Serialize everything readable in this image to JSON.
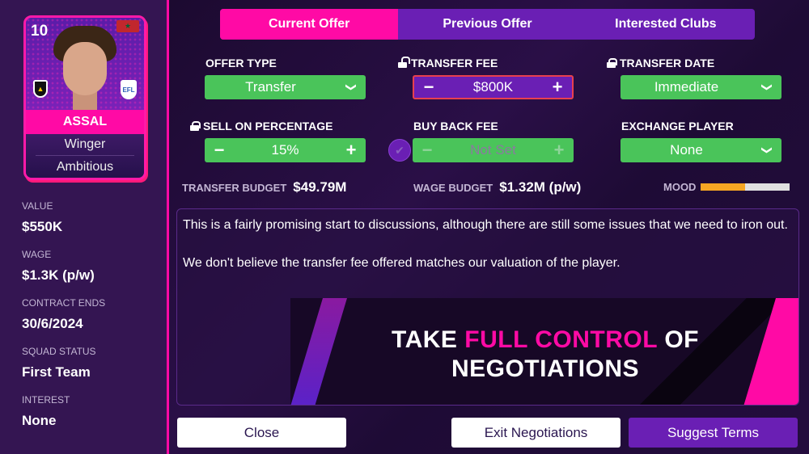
{
  "player": {
    "number": "10",
    "name": "ASSAL",
    "position": "Winger",
    "personality": "Ambitious",
    "flag": "Morocco",
    "club_badge": "club-crest",
    "league_badge": "EFL"
  },
  "stats": [
    {
      "label": "VALUE",
      "value": "$550K"
    },
    {
      "label": "WAGE",
      "value": "$1.3K (p/w)"
    },
    {
      "label": "CONTRACT ENDS",
      "value": "30/6/2024"
    },
    {
      "label": "SQUAD STATUS",
      "value": "First Team"
    },
    {
      "label": "INTEREST",
      "value": "None"
    }
  ],
  "tabs": [
    {
      "label": "Current Offer",
      "active": true
    },
    {
      "label": "Previous Offer",
      "active": false
    },
    {
      "label": "Interested Clubs",
      "active": false
    }
  ],
  "fields": {
    "offer_type": {
      "label": "OFFER TYPE",
      "value": "Transfer"
    },
    "transfer_fee": {
      "label": "TRANSFER FEE",
      "value": "$800K",
      "lock": "unlocked"
    },
    "transfer_date": {
      "label": "TRANSFER DATE",
      "value": "Immediate",
      "lock": "locked"
    },
    "sell_on": {
      "label": "SELL ON PERCENTAGE",
      "value": "15%",
      "lock": "locked"
    },
    "buy_back": {
      "label": "BUY BACK FEE",
      "value": "Not Set"
    },
    "exchange": {
      "label": "EXCHANGE PLAYER",
      "value": "None"
    }
  },
  "icons": {
    "minus": "−",
    "plus": "+",
    "chevron": "❯",
    "check": "✔",
    "star": "★"
  },
  "budgets": {
    "transfer_label": "TRANSFER BUDGET",
    "transfer_value": "$49.79M",
    "wage_label": "WAGE BUDGET",
    "wage_value": "$1.32M (p/w)",
    "mood_label": "MOOD",
    "mood_fraction": 0.5
  },
  "message": {
    "line1": "This is a fairly promising start to discussions, although there are still some issues that we need to iron out.",
    "line2": "We don't believe the transfer fee offered matches our valuation of the player."
  },
  "promo": {
    "part1": "TAKE ",
    "highlight": "FULL CONTROL",
    "part2": " OF",
    "line2": "NEGOTIATIONS"
  },
  "buttons": {
    "close": "Close",
    "exit": "Exit Negotiations",
    "suggest": "Suggest Terms"
  },
  "colors": {
    "accent_pink": "#ff0aa5",
    "accent_purple": "#6a1fb4",
    "green": "#4ac45a",
    "mood_orange": "#f5a623"
  }
}
